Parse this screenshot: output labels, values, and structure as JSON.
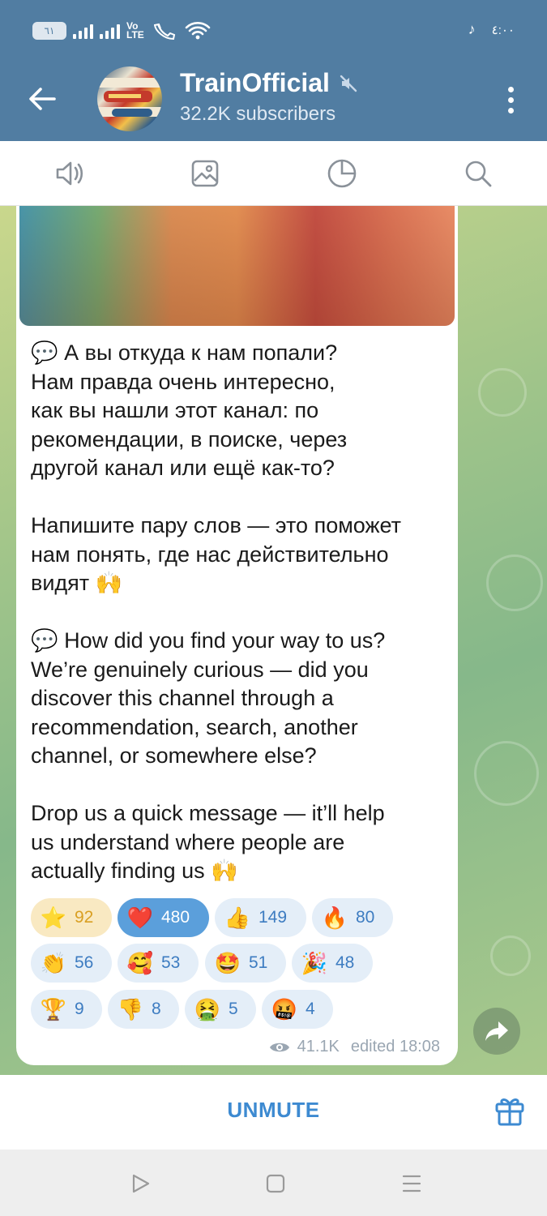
{
  "status_bar": {
    "battery": "٦١",
    "volte": "Vo LTE",
    "time": "٤:٠٠"
  },
  "header": {
    "channel_name": "TrainOfficial",
    "subscribers": "32.2K subscribers",
    "muted": true
  },
  "toolbar": {
    "items": [
      "audio-icon",
      "media-icon",
      "stats-icon",
      "search-icon"
    ]
  },
  "message": {
    "paragraphs": [
      "💬 А вы откуда к нам попали?\nНам правда очень интересно,\nкак вы нашли этот канал: по\nрекомендации, в поиске, через\nдругой канал или ещё как-то?",
      "Напишите пару слов — это поможет\nнам понять, где нас действительно\nвидят 🙌",
      "💬 How did you find your way to us?\nWe’re genuinely curious — did you\ndiscover this channel through a\nrecommendation, search, another\nchannel, or somewhere else?",
      "Drop us a quick message — it’ll help\nus understand where people are\nactually finding us 🙌"
    ],
    "reactions": [
      {
        "emoji": "⭐",
        "count": "92"
      },
      {
        "emoji": "❤️",
        "count": "480"
      },
      {
        "emoji": "👍",
        "count": "149"
      },
      {
        "emoji": "🔥",
        "count": "80"
      },
      {
        "emoji": "👏",
        "count": "56"
      },
      {
        "emoji": "🥰",
        "count": "53"
      },
      {
        "emoji": "🤩",
        "count": "51"
      },
      {
        "emoji": "🎉",
        "count": "48"
      },
      {
        "emoji": "🏆",
        "count": "9"
      },
      {
        "emoji": "👎",
        "count": "8"
      },
      {
        "emoji": "🤮",
        "count": "5"
      },
      {
        "emoji": "🤬",
        "count": "4"
      }
    ],
    "views": "41.1K",
    "edited": "edited 18:08"
  },
  "bottom_bar": {
    "unmute_label": "UNMUTE"
  },
  "colors": {
    "header_bg": "#517da2",
    "accent": "#3d8ad1",
    "reaction_selected": "#5b9fdb",
    "reaction_star": "#f9e9c2"
  }
}
